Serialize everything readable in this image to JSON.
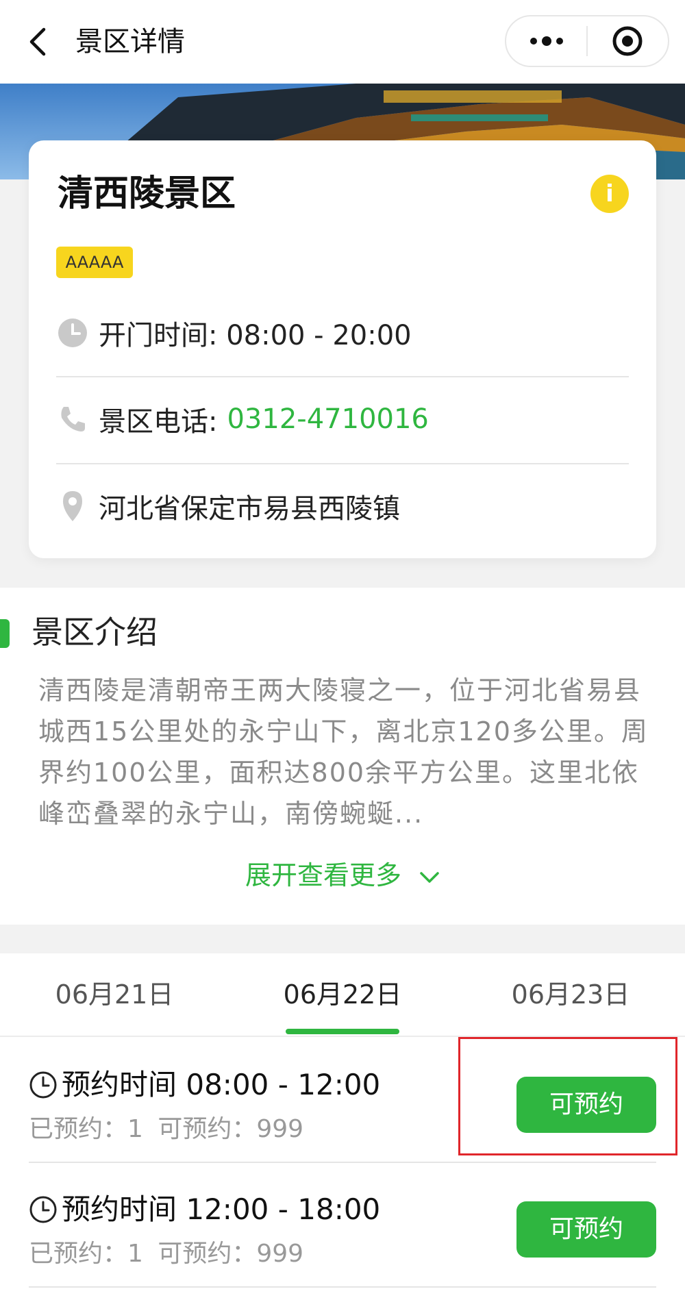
{
  "nav": {
    "title": "景区详情",
    "back_icon": "chevron-left-icon",
    "more_icon": "more-dots-icon",
    "close_icon": "target-circle-icon"
  },
  "hero": {
    "image": "temple-roof-photo"
  },
  "info": {
    "name": "清西陵景区",
    "rating": "AAAAA",
    "info_icon_text": "i",
    "hours_label": "开门时间: 08:00 - 20:00",
    "phone_label": "景区电话:",
    "phone": "0312-4710016",
    "address": "河北省保定市易县西陵镇"
  },
  "intro": {
    "title": "景区介绍",
    "text": "清西陵是清朝帝王两大陵寝之一，位于河北省易县城西15公里处的永宁山下，离北京120多公里。周界约100公里，面积达800余平方公里。这里北依峰峦叠翠的永宁山，南傍蜿蜒...",
    "expand_label": "展开查看更多"
  },
  "booking": {
    "dates": [
      "06月21日",
      "06月22日",
      "06月23日"
    ],
    "active_date_index": 1,
    "slots": [
      {
        "time": "预约时间 08:00 - 12:00",
        "booked": "已预约：1",
        "available": "可预约：999",
        "button": "可预约"
      },
      {
        "time": "预约时间 12:00 - 18:00",
        "booked": "已预约：1",
        "available": "可预约：999",
        "button": "可预约"
      }
    ]
  },
  "colors": {
    "accent_green": "#2fb640",
    "badge_yellow": "#f7d51e",
    "highlight_red": "#e0262b"
  }
}
